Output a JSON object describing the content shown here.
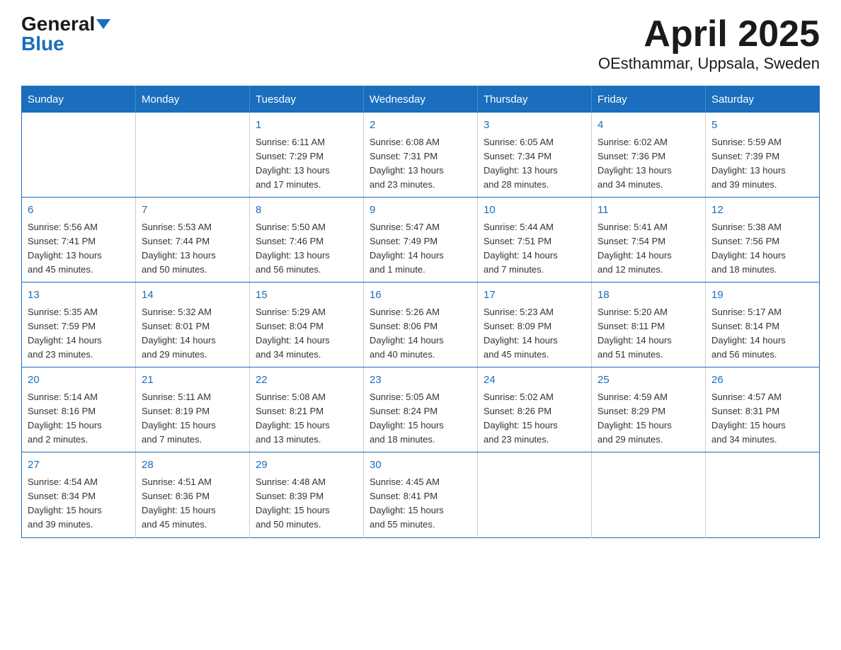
{
  "logo": {
    "general": "General",
    "blue": "Blue"
  },
  "header": {
    "title": "April 2025",
    "subtitle": "OEsthammar, Uppsala, Sweden"
  },
  "weekdays": [
    "Sunday",
    "Monday",
    "Tuesday",
    "Wednesday",
    "Thursday",
    "Friday",
    "Saturday"
  ],
  "weeks": [
    [
      {
        "day": "",
        "info": ""
      },
      {
        "day": "",
        "info": ""
      },
      {
        "day": "1",
        "info": "Sunrise: 6:11 AM\nSunset: 7:29 PM\nDaylight: 13 hours\nand 17 minutes."
      },
      {
        "day": "2",
        "info": "Sunrise: 6:08 AM\nSunset: 7:31 PM\nDaylight: 13 hours\nand 23 minutes."
      },
      {
        "day": "3",
        "info": "Sunrise: 6:05 AM\nSunset: 7:34 PM\nDaylight: 13 hours\nand 28 minutes."
      },
      {
        "day": "4",
        "info": "Sunrise: 6:02 AM\nSunset: 7:36 PM\nDaylight: 13 hours\nand 34 minutes."
      },
      {
        "day": "5",
        "info": "Sunrise: 5:59 AM\nSunset: 7:39 PM\nDaylight: 13 hours\nand 39 minutes."
      }
    ],
    [
      {
        "day": "6",
        "info": "Sunrise: 5:56 AM\nSunset: 7:41 PM\nDaylight: 13 hours\nand 45 minutes."
      },
      {
        "day": "7",
        "info": "Sunrise: 5:53 AM\nSunset: 7:44 PM\nDaylight: 13 hours\nand 50 minutes."
      },
      {
        "day": "8",
        "info": "Sunrise: 5:50 AM\nSunset: 7:46 PM\nDaylight: 13 hours\nand 56 minutes."
      },
      {
        "day": "9",
        "info": "Sunrise: 5:47 AM\nSunset: 7:49 PM\nDaylight: 14 hours\nand 1 minute."
      },
      {
        "day": "10",
        "info": "Sunrise: 5:44 AM\nSunset: 7:51 PM\nDaylight: 14 hours\nand 7 minutes."
      },
      {
        "day": "11",
        "info": "Sunrise: 5:41 AM\nSunset: 7:54 PM\nDaylight: 14 hours\nand 12 minutes."
      },
      {
        "day": "12",
        "info": "Sunrise: 5:38 AM\nSunset: 7:56 PM\nDaylight: 14 hours\nand 18 minutes."
      }
    ],
    [
      {
        "day": "13",
        "info": "Sunrise: 5:35 AM\nSunset: 7:59 PM\nDaylight: 14 hours\nand 23 minutes."
      },
      {
        "day": "14",
        "info": "Sunrise: 5:32 AM\nSunset: 8:01 PM\nDaylight: 14 hours\nand 29 minutes."
      },
      {
        "day": "15",
        "info": "Sunrise: 5:29 AM\nSunset: 8:04 PM\nDaylight: 14 hours\nand 34 minutes."
      },
      {
        "day": "16",
        "info": "Sunrise: 5:26 AM\nSunset: 8:06 PM\nDaylight: 14 hours\nand 40 minutes."
      },
      {
        "day": "17",
        "info": "Sunrise: 5:23 AM\nSunset: 8:09 PM\nDaylight: 14 hours\nand 45 minutes."
      },
      {
        "day": "18",
        "info": "Sunrise: 5:20 AM\nSunset: 8:11 PM\nDaylight: 14 hours\nand 51 minutes."
      },
      {
        "day": "19",
        "info": "Sunrise: 5:17 AM\nSunset: 8:14 PM\nDaylight: 14 hours\nand 56 minutes."
      }
    ],
    [
      {
        "day": "20",
        "info": "Sunrise: 5:14 AM\nSunset: 8:16 PM\nDaylight: 15 hours\nand 2 minutes."
      },
      {
        "day": "21",
        "info": "Sunrise: 5:11 AM\nSunset: 8:19 PM\nDaylight: 15 hours\nand 7 minutes."
      },
      {
        "day": "22",
        "info": "Sunrise: 5:08 AM\nSunset: 8:21 PM\nDaylight: 15 hours\nand 13 minutes."
      },
      {
        "day": "23",
        "info": "Sunrise: 5:05 AM\nSunset: 8:24 PM\nDaylight: 15 hours\nand 18 minutes."
      },
      {
        "day": "24",
        "info": "Sunrise: 5:02 AM\nSunset: 8:26 PM\nDaylight: 15 hours\nand 23 minutes."
      },
      {
        "day": "25",
        "info": "Sunrise: 4:59 AM\nSunset: 8:29 PM\nDaylight: 15 hours\nand 29 minutes."
      },
      {
        "day": "26",
        "info": "Sunrise: 4:57 AM\nSunset: 8:31 PM\nDaylight: 15 hours\nand 34 minutes."
      }
    ],
    [
      {
        "day": "27",
        "info": "Sunrise: 4:54 AM\nSunset: 8:34 PM\nDaylight: 15 hours\nand 39 minutes."
      },
      {
        "day": "28",
        "info": "Sunrise: 4:51 AM\nSunset: 8:36 PM\nDaylight: 15 hours\nand 45 minutes."
      },
      {
        "day": "29",
        "info": "Sunrise: 4:48 AM\nSunset: 8:39 PM\nDaylight: 15 hours\nand 50 minutes."
      },
      {
        "day": "30",
        "info": "Sunrise: 4:45 AM\nSunset: 8:41 PM\nDaylight: 15 hours\nand 55 minutes."
      },
      {
        "day": "",
        "info": ""
      },
      {
        "day": "",
        "info": ""
      },
      {
        "day": "",
        "info": ""
      }
    ]
  ]
}
